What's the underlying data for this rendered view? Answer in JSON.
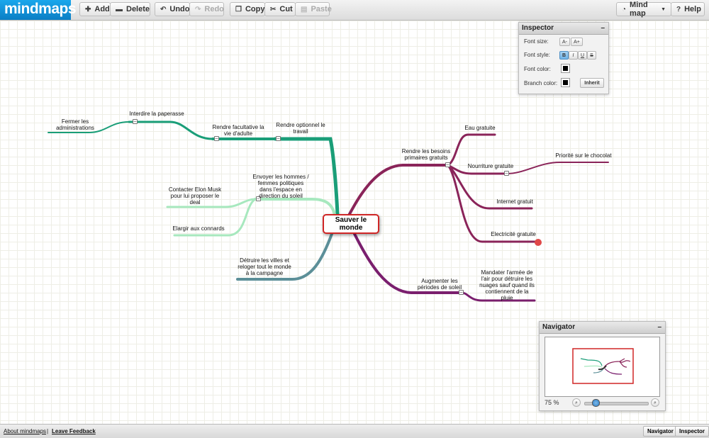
{
  "app": {
    "logo": "mindmaps"
  },
  "toolbar": {
    "add": "Add",
    "delete": "Delete",
    "undo": "Undo",
    "redo": "Redo",
    "copy": "Copy",
    "cut": "Cut",
    "paste": "Paste",
    "mindmap": "Mind map",
    "help": "Help"
  },
  "map": {
    "central": "Sauver le monde",
    "nodes": {
      "rendre_optionnel": "Rendre optionnel le travail",
      "rendre_facultative": "Rendre facultative la vie d'adulte",
      "interdire": "Interdire la paperasse",
      "fermer": "Fermer les administrations",
      "envoyer": "Envoyer les hommes / femmes politiques dans l'espace en direction du soleil",
      "contacter": "Contacter Elon Musk pour lui proposer le deal",
      "elargir": "Elargir aux connards",
      "detruire": "Détruire les villes et reloger tout le monde à la campagne",
      "besoins": "Rendre les besoins primaires gratuits",
      "eau": "Eau gratuite",
      "nourriture": "Nourriture gratuite",
      "chocolat": "Priorité sur le chocolat",
      "internet": "Internet gratuit",
      "electricite": "Electricité gratuite",
      "augmenter": "Augmenter les périodes de soleil",
      "mandater": "Mandater l'armée de l'air pour détruire les nuages sauf quand ils contiennent de la pluie"
    }
  },
  "inspector": {
    "title": "Inspector",
    "font_size": "Font size:",
    "font_style": "Font style:",
    "font_color": "Font color:",
    "branch_color": "Branch color:",
    "size_down": "A-",
    "size_up": "A+",
    "bold": "B",
    "italic": "I",
    "underline": "U",
    "strike": "S",
    "inherit": "Inherit"
  },
  "navigator": {
    "title": "Navigator",
    "zoom": "75 %"
  },
  "footer": {
    "about": "About mindmaps",
    "sep": "|",
    "feedback": "Leave Feedback",
    "navigator": "Navigator",
    "inspector": "Inspector"
  },
  "colors": {
    "teal": "#1a9e78",
    "mint": "#a7e8be",
    "slate": "#5c8f98",
    "plum": "#8a2459",
    "purple": "#7a1f6e",
    "selected": "#e04848"
  }
}
